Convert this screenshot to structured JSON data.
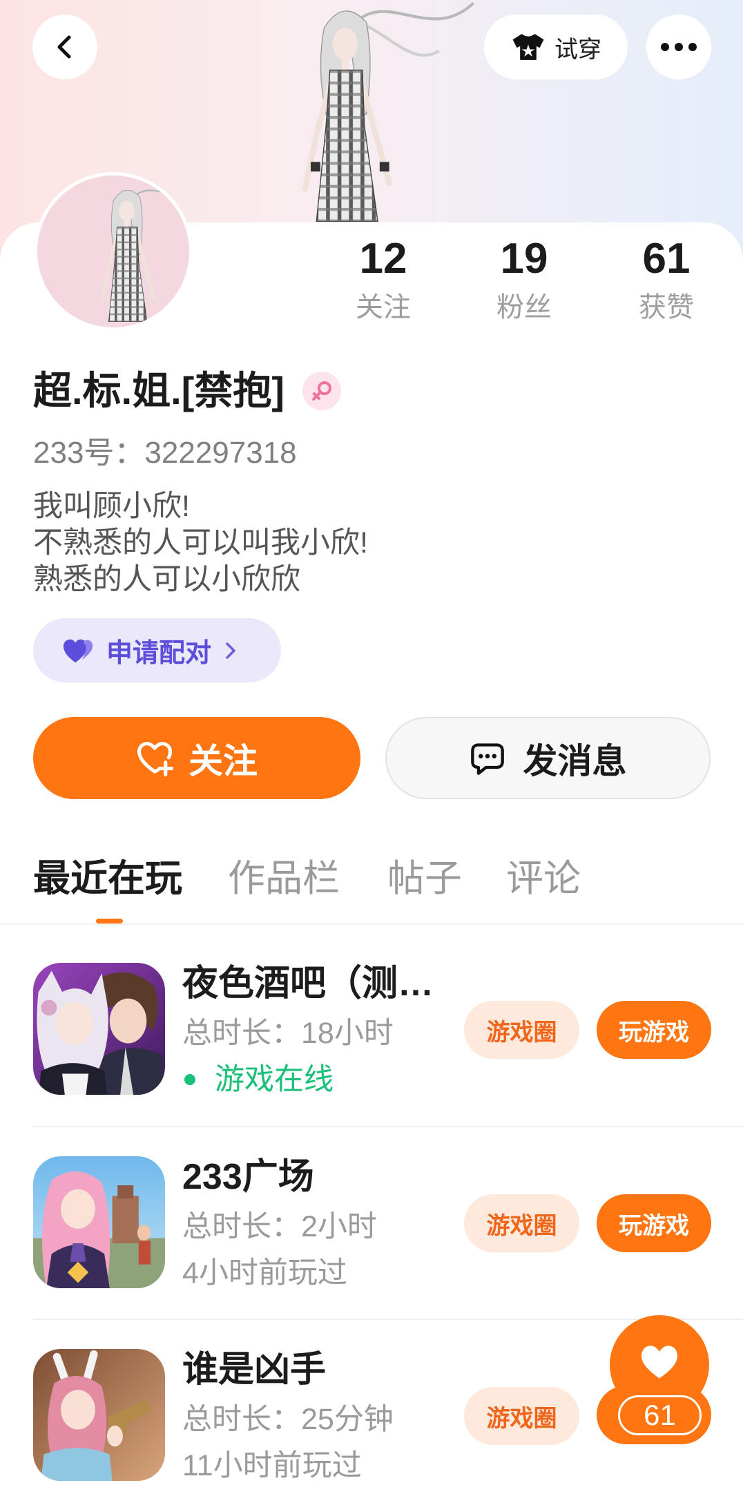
{
  "colors": {
    "accent": "#ff7511",
    "accent_light": "#fee9dc",
    "accent_text": "#f0661a",
    "online_green": "#19c07a",
    "pair_purple": "#5c4ddb",
    "pair_bg": "#ebe8fb",
    "gender_pink": "#f2709c"
  },
  "header": {
    "back_icon": "chevron-left-icon",
    "try_on": {
      "icon": "shirt-icon",
      "label": "试穿"
    },
    "more_icon": "more-dots-icon"
  },
  "profile": {
    "stats": [
      {
        "value": "12",
        "label": "关注"
      },
      {
        "value": "19",
        "label": "粉丝"
      },
      {
        "value": "61",
        "label": "获赞"
      }
    ],
    "name": "超.标.姐.[禁抱]",
    "gender_icon": "female-icon",
    "id_text": "233号：322297318",
    "bio": [
      "我叫顾小欣!",
      "不熟悉的人可以叫我小欣!",
      "熟悉的人可以小欣欣"
    ],
    "pair_button": {
      "icon": "heart-pair-icon",
      "label": "申请配对"
    }
  },
  "actions": {
    "follow": {
      "icon": "heart-plus-icon",
      "label": "关注"
    },
    "message": {
      "icon": "chat-bubble-icon",
      "label": "发消息"
    }
  },
  "tabs": [
    {
      "label": "最近在玩",
      "active": true
    },
    {
      "label": "作品栏",
      "active": false
    },
    {
      "label": "帖子",
      "active": false
    },
    {
      "label": "评论",
      "active": false
    }
  ],
  "games": [
    {
      "title": "夜色酒吧（测…",
      "duration": "总时长：18小时",
      "status": "游戏在线",
      "online": true,
      "circle_label": "游戏圈",
      "play_label": "玩游戏"
    },
    {
      "title": "233广场",
      "duration": "总时长：2小时",
      "status": "4小时前玩过",
      "online": false,
      "circle_label": "游戏圈",
      "play_label": "玩游戏"
    },
    {
      "title": "谁是凶手",
      "duration": "总时长：25分钟",
      "status": "11小时前玩过",
      "online": false,
      "circle_label": "游戏圈"
    }
  ],
  "floating_like": {
    "icon": "heart-icon",
    "count": "61"
  }
}
